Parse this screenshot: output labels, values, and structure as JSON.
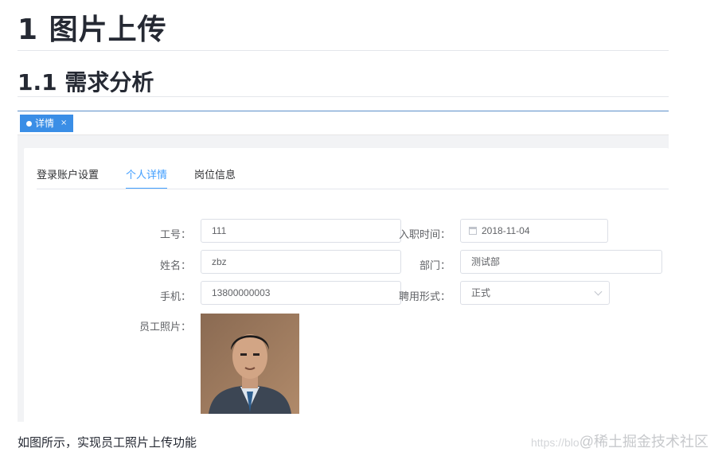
{
  "article": {
    "h1": "1 图片上传",
    "h2": "1.1 需求分析",
    "caption": "如图所示，实现员工照片上传功能"
  },
  "screenshot": {
    "tag_label": "详情",
    "tag_close": "×",
    "tabs": [
      {
        "label": "登录账户设置",
        "active": false
      },
      {
        "label": "个人详情",
        "active": true
      },
      {
        "label": "岗位信息",
        "active": false
      }
    ],
    "form": {
      "job_no_label": "工号：",
      "job_no_value": "111",
      "join_date_label": "入职时间：",
      "join_date_value": "2018-11-04",
      "name_label": "姓名：",
      "name_value": "zbz",
      "dept_label": "部门：",
      "dept_value": "测试部",
      "phone_label": "手机：",
      "phone_value": "13800000003",
      "employ_type_label": "聘用形式：",
      "employ_type_value": "正式",
      "photo_label": "员工照片："
    }
  },
  "watermark": {
    "site": "https://blo",
    "brand": "@稀土掘金技术社区"
  },
  "colors": {
    "accent": "#409eff",
    "tag_bg": "#3a8ee6"
  }
}
